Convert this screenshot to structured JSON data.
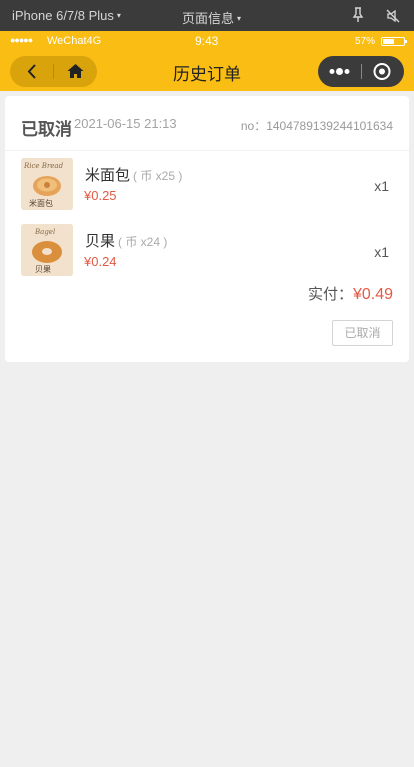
{
  "devbar": {
    "device": "iPhone 6/7/8 Plus",
    "page_info": "页面信息",
    "caret": "▾"
  },
  "statusbar": {
    "signal": "●●●●●",
    "carrier": "WeChat4G",
    "time": "9:43",
    "battery_percent": "57%",
    "battery_level": 0.57
  },
  "navbar": {
    "title": "历史订单",
    "accent_color": "#f9bd13"
  },
  "order": {
    "status": "已取消",
    "datetime": "2021-06-15 21:13",
    "order_no": "no：1404789139244101634",
    "items": [
      {
        "name": "米面包",
        "coin": "( 币 x25 )",
        "price": "¥0.25",
        "qty": "x1",
        "thumb_icon": "rice-bread-icon"
      },
      {
        "name": "贝果",
        "coin": "( 币 x24 )",
        "price": "¥0.24",
        "qty": "x1",
        "thumb_icon": "bagel-icon"
      }
    ],
    "total_label": "实付：",
    "total_amount": "¥0.49",
    "cancelled_button": "已取消",
    "price_color": "#e25a44"
  }
}
